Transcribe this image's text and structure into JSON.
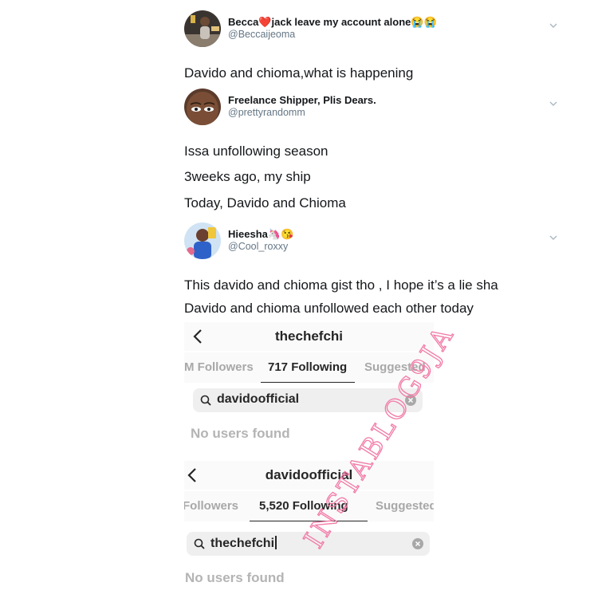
{
  "tweets": [
    {
      "name": "Becca❤️jack leave my account alone😭😭",
      "handle": "@Beccaijeoma",
      "lines": [
        "Davido and chioma,what is happening"
      ]
    },
    {
      "name": "Freelance Shipper, Plis Dears.",
      "handle": "@prettyrandomm",
      "lines": [
        "Issa unfollowing season",
        "3weeks ago, my ship",
        "Today, Davido and Chioma"
      ]
    },
    {
      "name": "Hieesha🦄😘",
      "handle": "@Cool_roxxy",
      "lines": [
        "This davido and chioma gist tho , I hope it’s a lie sha",
        "Davido and chioma unfollowed each other today"
      ]
    }
  ],
  "instagram": [
    {
      "account": "thechefchi",
      "tab_followers": "M Followers",
      "tab_following": "717 Following",
      "tab_suggested": "Suggested",
      "search_query": "davidoofficial",
      "empty_message": "No users found"
    },
    {
      "account": "davidoofficial",
      "tab_followers": "Followers",
      "tab_following": "5,520 Following",
      "tab_suggested": "Suggested",
      "search_query": "thechefchi",
      "empty_message": "No users found"
    }
  ],
  "watermark": "INSTABLOG9JA",
  "colors": {
    "handle": "#657786",
    "watermark": "#f27aa6",
    "empty_text": "#b4b4b4"
  },
  "icons": [
    "chevron-down-icon",
    "back-arrow-icon",
    "search-icon",
    "clear-icon"
  ]
}
